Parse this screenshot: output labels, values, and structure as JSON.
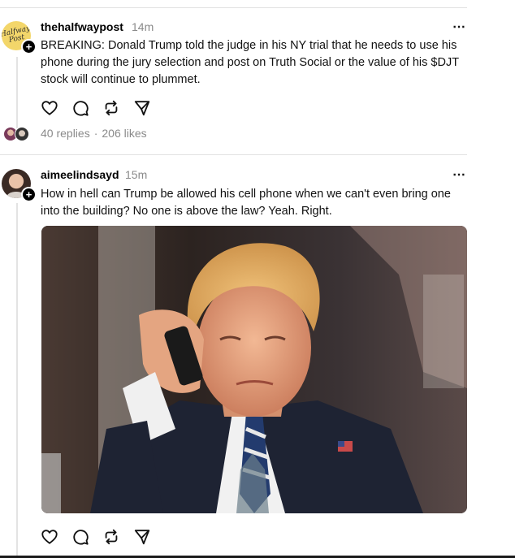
{
  "posts": [
    {
      "username": "thehalfwaypost",
      "time": "14m",
      "avatar_text": "Halfway Post",
      "text": "BREAKING: Donald Trump told the judge in his NY trial that he needs to use his phone during the jury selection and post on Truth Social or the value of his $DJT stock will continue to plummet.",
      "replies": "40 replies",
      "separator": "·",
      "likes": "206 likes",
      "more_icon": "more-horizontal-icon"
    },
    {
      "username": "aimeelindsayd",
      "time": "15m",
      "text": "How in hell can Trump be allowed his cell phone when we can't even bring one into the building? No one is above the law? Yeah. Right.",
      "image_icon": "photo-man-on-phone",
      "more_icon": "more-horizontal-icon"
    }
  ],
  "icons": {
    "more": "⋯",
    "follow": "+",
    "like": "heart-icon",
    "reply": "comment-icon",
    "repost": "repost-icon",
    "share": "send-icon"
  },
  "colors": {
    "muted_text": "#8a8a8a",
    "divider": "#e2e2e2",
    "text": "#111111"
  }
}
